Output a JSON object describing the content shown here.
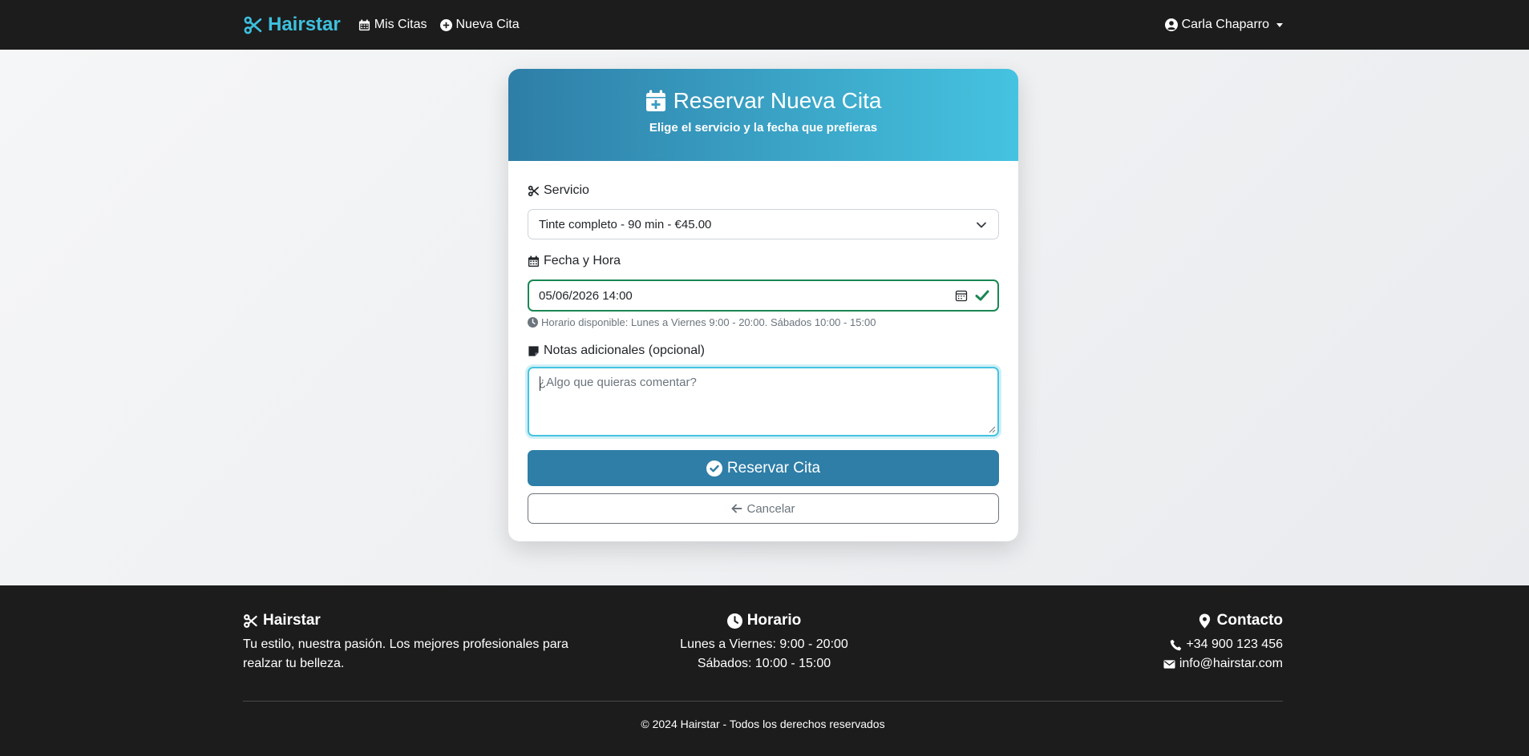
{
  "navbar": {
    "brand": "Hairstar",
    "links": [
      {
        "label": "Mis Citas",
        "icon": "calendar-icon"
      },
      {
        "label": "Nueva Cita",
        "icon": "plus-circle-icon"
      }
    ],
    "user_name": "Carla Chaparro"
  },
  "form": {
    "title": "Reservar Nueva Cita",
    "subtitle": "Elige el servicio y la fecha que prefieras",
    "servicio_label": "Servicio",
    "servicio_value": "Tinte completo - 90 min - €45.00",
    "fecha_label": "Fecha y Hora",
    "fecha_value": "05/06/2026 14:00",
    "horario_help": "Horario disponible: Lunes a Viernes 9:00 - 20:00. Sábados 10:00 - 15:00",
    "notas_label": "Notas adicionales (opcional)",
    "notas_placeholder": "¿Algo que quieras comentar?",
    "submit_label": "Reservar Cita",
    "cancel_label": "Cancelar"
  },
  "footer": {
    "brand_title": "Hairstar",
    "brand_text": "Tu estilo, nuestra pasión. Los mejores profesionales para realzar tu belleza.",
    "horario_title": "Horario",
    "horario_lines": [
      "Lunes a Viernes: 9:00 - 20:00",
      "Sábados: 10:00 - 15:00"
    ],
    "contacto_title": "Contacto",
    "phone": "+34 900 123 456",
    "email": "info@hairstar.com",
    "copyright": "© 2024 Hairstar - Todos los derechos reservados"
  },
  "colors": {
    "accent": "#3ec0de",
    "primary": "#2e7ea7",
    "success": "#198754",
    "dark": "#1c1c1c"
  }
}
